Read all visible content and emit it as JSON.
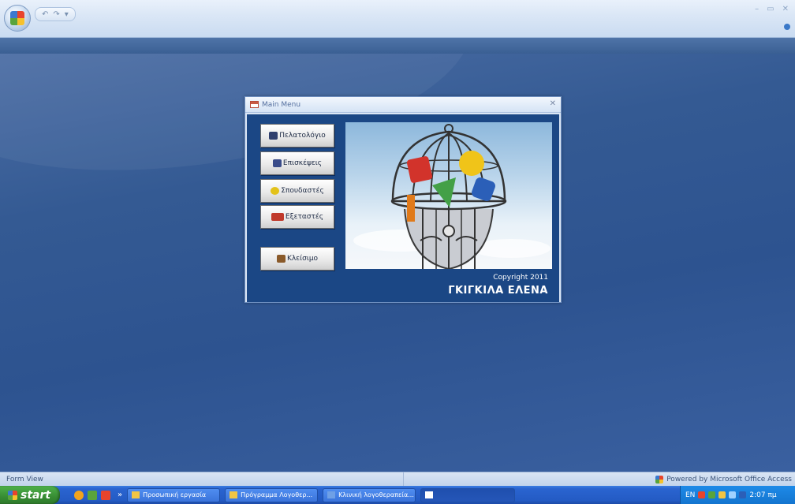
{
  "app": {
    "quick_access": [
      "↶",
      "↷",
      "▾"
    ],
    "window_controls": [
      "–",
      "▭",
      "✕"
    ]
  },
  "form": {
    "title": "Main Menu",
    "close_label": "✕",
    "buttons": [
      {
        "label": "Πελατολόγιο",
        "icon": "customers-icon",
        "color": "#2f3f6e"
      },
      {
        "label": "Επισκέψεις",
        "icon": "visits-icon",
        "color": "#3a4c8a"
      },
      {
        "label": "Σπουδαστές",
        "icon": "smiley-icon",
        "color": "#e3c21a"
      },
      {
        "label": "Εξεταστές",
        "icon": "examiners-icon",
        "color": "#c0392b"
      },
      {
        "label": "Κλείσιμο",
        "icon": "exit-door-icon",
        "color": "#8a5a2a"
      }
    ],
    "copyright": "Copyright 2011",
    "author": "ΓΚΙΓΚΙΛΑ ΕΛΕΝΑ"
  },
  "statusbar": {
    "left": "Form View",
    "right": "Powered by Microsoft Office Access"
  },
  "taskbar": {
    "start_label": "start",
    "quick_more": "»",
    "tasks": [
      {
        "label": "Προσωπική εργασία",
        "active": false
      },
      {
        "label": "Πρόγραμμα Λογοθερ...",
        "active": false
      },
      {
        "label": "Κλινική λογοθεραπεία...",
        "active": false
      },
      {
        "label": "",
        "active": true
      }
    ],
    "clock": "2:07 πμ",
    "lang": "EN"
  },
  "colors": {
    "workspace": "#2d5390",
    "form_body": "#1b4785",
    "taskbar": "#245bc4"
  }
}
